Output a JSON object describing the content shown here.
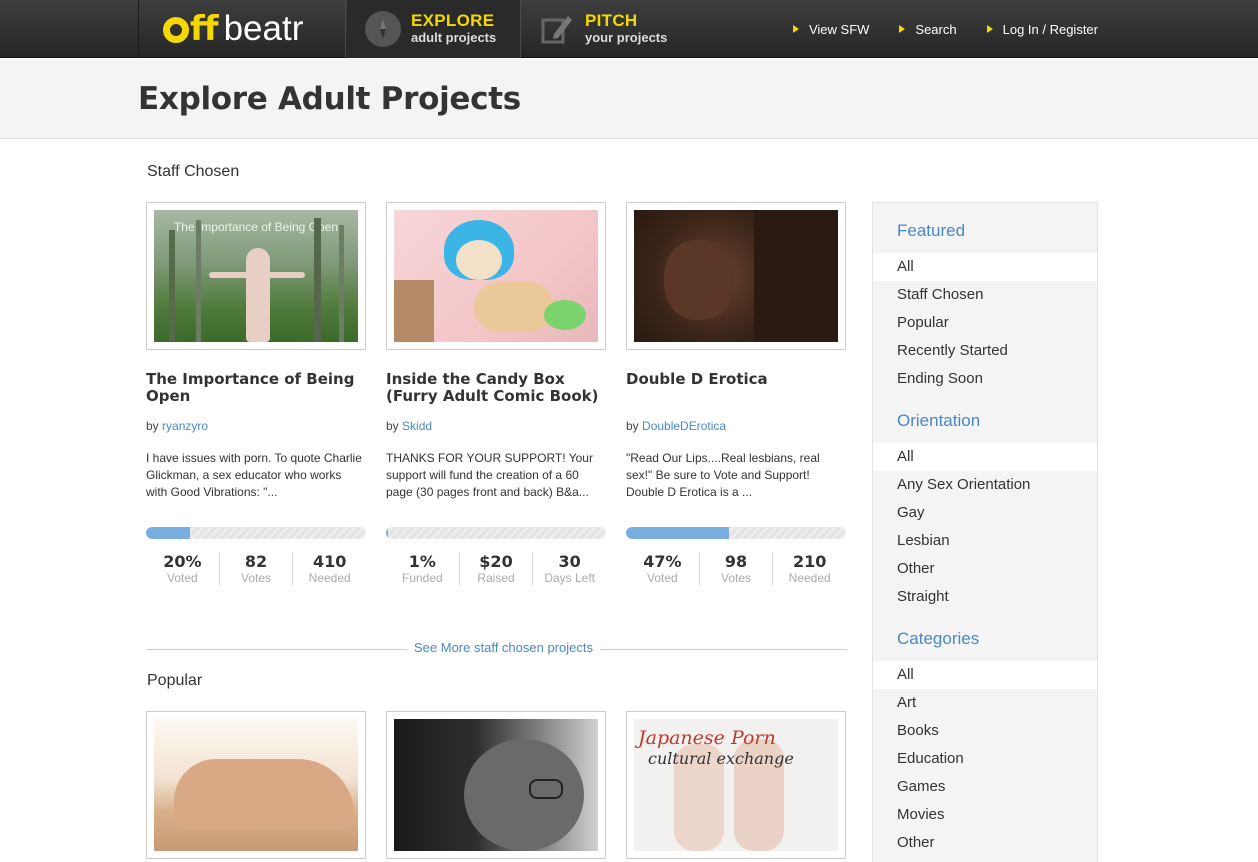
{
  "header": {
    "logo_off": "ff",
    "logo_beatr": "beatr",
    "nav": [
      {
        "title": "EXPLORE",
        "subtitle": "adult projects",
        "icon": "compass-icon"
      },
      {
        "title": "PITCH",
        "subtitle": "your projects",
        "icon": "pencil-icon"
      }
    ],
    "links": [
      "View SFW",
      "Search",
      "Log In / Register"
    ]
  },
  "page_title": "Explore Adult Projects",
  "sections": {
    "staff": {
      "title": "Staff Chosen",
      "see_more": "See More staff chosen projects",
      "cards": [
        {
          "image_caption": "The Importance of Being Open",
          "title": "The Importance of Being Open",
          "by_label": "by",
          "author": "ryanzyro",
          "description": "I have issues with porn. To quote Charlie Glickman, a sex educator who works with Good Vibrations: \"...",
          "progress": 0.2,
          "stats": [
            {
              "value": "20%",
              "label": "Voted"
            },
            {
              "value": "82",
              "label": "Votes"
            },
            {
              "value": "410",
              "label": "Needed"
            }
          ]
        },
        {
          "title": "Inside the Candy Box (Furry Adult Comic Book)",
          "by_label": "by",
          "author": "Skidd",
          "description": "THANKS FOR YOUR SUPPORT! Your support will fund the creation of a 60 page (30 pages front and back) B&a...",
          "progress": 0.01,
          "stats": [
            {
              "value": "1%",
              "label": "Funded"
            },
            {
              "value": "$20",
              "label": "Raised"
            },
            {
              "value": "30",
              "label": "Days Left"
            }
          ]
        },
        {
          "title": "Double D Erotica",
          "by_label": "by",
          "author": "DoubleDErotica",
          "description": "\"Read Our Lips....Real lesbians, real sex!\" Be sure to Vote and Support! Double D Erotica is a ...",
          "progress": 0.47,
          "stats": [
            {
              "value": "47%",
              "label": "Voted"
            },
            {
              "value": "98",
              "label": "Votes"
            },
            {
              "value": "210",
              "label": "Needed"
            }
          ]
        }
      ]
    },
    "popular": {
      "title": "Popular",
      "cards": [
        {
          "image_caption": ""
        },
        {
          "image_caption": ""
        },
        {
          "image_caption_line1": "Japanese Porn",
          "image_caption_line2": "cultural exchange"
        }
      ]
    }
  },
  "sidebar": {
    "groups": [
      {
        "heading": "Featured",
        "items": [
          "All",
          "Staff Chosen",
          "Popular",
          "Recently Started",
          "Ending Soon"
        ]
      },
      {
        "heading": "Orientation",
        "items": [
          "All",
          "Any Sex Orientation",
          "Gay",
          "Lesbian",
          "Other",
          "Straight"
        ]
      },
      {
        "heading": "Categories",
        "items": [
          "All",
          "Art",
          "Books",
          "Education",
          "Games",
          "Movies",
          "Other"
        ]
      }
    ]
  },
  "colors": {
    "accent": "#f5d800",
    "link": "#4a88c9",
    "progress": "#7aaee0"
  }
}
